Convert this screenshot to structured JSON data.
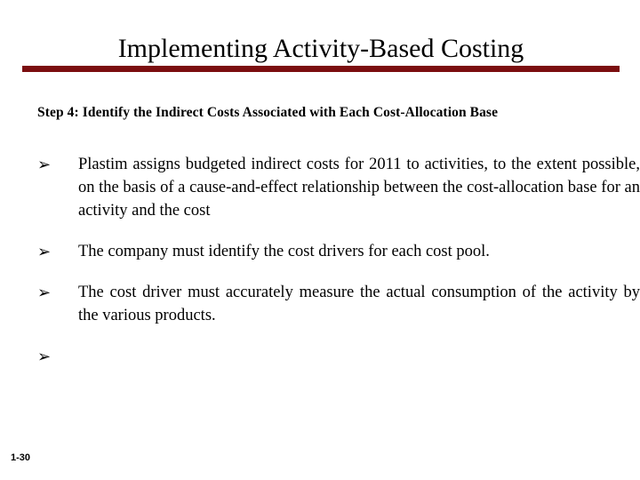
{
  "slide": {
    "title": "Implementing Activity-Based Costing",
    "subtitle": "Step 4: Identify the Indirect Costs Associated with Each Cost-Allocation Base",
    "bullet_marker": "➢",
    "bullets": [
      {
        "marker": "➢",
        "text": "Plastim assigns budgeted indirect costs for 2011 to activities, to the extent possible, on the basis of a cause-and-effect relationship between the cost-allocation base for an activity and the cost"
      },
      {
        "marker": "➢",
        "text": "The company must identify the cost drivers for each cost pool."
      },
      {
        "marker": "➢",
        "text": "The cost driver must accurately measure the actual consumption of the activity by the various products."
      },
      {
        "marker": "➢",
        "text": ""
      }
    ],
    "footer_page": "1-30",
    "colors": {
      "accent_rule": "#7B0E10",
      "text": "#000000",
      "background": "#FFFFFF"
    }
  }
}
